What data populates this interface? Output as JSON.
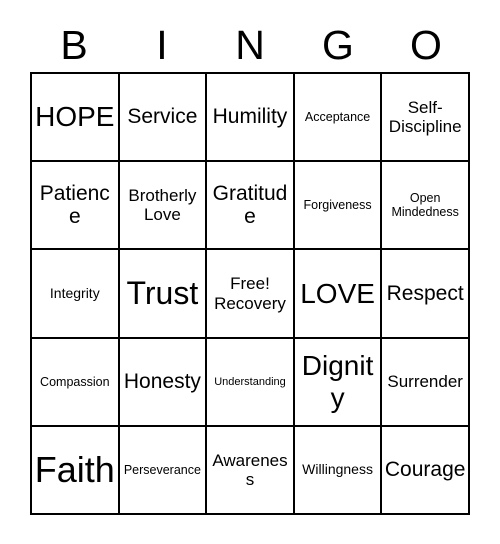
{
  "card": {
    "title": "Bingo Card",
    "header": {
      "letters": [
        "B",
        "I",
        "N",
        "G",
        "O"
      ]
    },
    "colors": {
      "background": "#ffffff",
      "border": "#000000",
      "text": "#000000"
    },
    "grid": {
      "columns": 5,
      "rows": 5,
      "free_space": "Free!\nRecovery",
      "cells": [
        [
          {
            "label": "HOPE",
            "size": "lg"
          },
          {
            "label": "Service",
            "size": "md"
          },
          {
            "label": "Humility",
            "size": "md"
          },
          {
            "label": "Acceptance",
            "size": "xxs"
          },
          {
            "label": "Self-\nDiscipline",
            "size": "sm"
          }
        ],
        [
          {
            "label": "Patience",
            "size": "md"
          },
          {
            "label": "Brotherly\nLove",
            "size": "sm"
          },
          {
            "label": "Gratitude",
            "size": "md"
          },
          {
            "label": "Forgiveness",
            "size": "xxs"
          },
          {
            "label": "Open\nMindedness",
            "size": "xxs"
          }
        ],
        [
          {
            "label": "Integrity",
            "size": "xs"
          },
          {
            "label": "Trust",
            "size": "xl"
          },
          {
            "label": "Free!\nRecovery",
            "size": "sm"
          },
          {
            "label": "LOVE",
            "size": "lg"
          },
          {
            "label": "Respect",
            "size": "md"
          }
        ],
        [
          {
            "label": "Compassion",
            "size": "xxs"
          },
          {
            "label": "Honesty",
            "size": "md"
          },
          {
            "label": "Understanding",
            "size": "tiny"
          },
          {
            "label": "Dignity",
            "size": "lg"
          },
          {
            "label": "Surrender",
            "size": "sm"
          }
        ],
        [
          {
            "label": "Faith",
            "size": "xxl"
          },
          {
            "label": "Perseverance",
            "size": "xxs"
          },
          {
            "label": "Awareness",
            "size": "sm"
          },
          {
            "label": "Willingness",
            "size": "xs"
          },
          {
            "label": "Courage",
            "size": "md"
          }
        ]
      ]
    }
  }
}
